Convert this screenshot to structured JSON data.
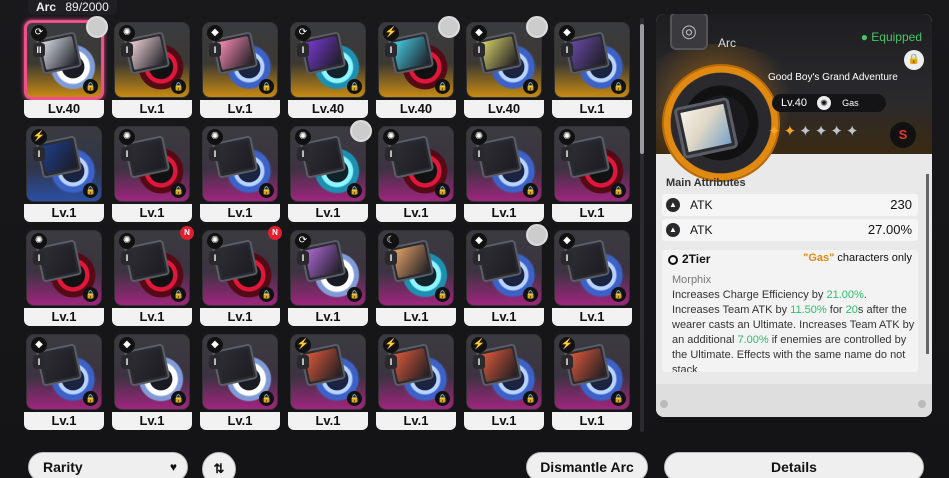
{
  "header": {
    "category": "Arc",
    "count": "89/2000"
  },
  "items": [
    {
      "level": "Lv.40",
      "rarity": "gold",
      "disc": "white",
      "tier": "II",
      "elem": "⟳",
      "art": "#d9e0ea",
      "avatar": true,
      "newbadge": false,
      "selected": true
    },
    {
      "level": "Lv.1",
      "rarity": "gold",
      "disc": "red",
      "tier": "I",
      "elem": "✺",
      "art": "#f2d7dc",
      "avatar": false,
      "newbadge": false,
      "selected": false
    },
    {
      "level": "Lv.1",
      "rarity": "gold",
      "disc": "blue",
      "tier": "I",
      "elem": "◆",
      "art": "#ff8fb6",
      "avatar": false,
      "newbadge": false,
      "selected": false
    },
    {
      "level": "Lv.40",
      "rarity": "gold",
      "disc": "cyan",
      "tier": "I",
      "elem": "⟳",
      "art": "#7a3ad6",
      "avatar": false,
      "newbadge": false,
      "selected": false
    },
    {
      "level": "Lv.40",
      "rarity": "gold",
      "disc": "red",
      "tier": "I",
      "elem": "⚡",
      "art": "#48d0e8",
      "avatar": true,
      "newbadge": false,
      "selected": false
    },
    {
      "level": "Lv.40",
      "rarity": "gold",
      "disc": "blue",
      "tier": "I",
      "elem": "◆",
      "art": "#d9d36a",
      "avatar": true,
      "newbadge": false,
      "selected": false
    },
    {
      "level": "Lv.1",
      "rarity": "gold",
      "disc": "blue",
      "tier": "I",
      "elem": "◆",
      "art": "#6a4aa8",
      "avatar": false,
      "newbadge": false,
      "selected": false
    },
    {
      "level": "Lv.1",
      "rarity": "blue",
      "disc": "blue",
      "tier": "I",
      "elem": "⚡",
      "art": "#1e3f8e",
      "avatar": false,
      "newbadge": false,
      "selected": false
    },
    {
      "level": "Lv.1",
      "rarity": "purple",
      "disc": "red",
      "tier": "I",
      "elem": "✺",
      "art": "#2e2e34",
      "avatar": false,
      "newbadge": false,
      "selected": false
    },
    {
      "level": "Lv.1",
      "rarity": "purple",
      "disc": "blue",
      "tier": "I",
      "elem": "✺",
      "art": "#2e2e34",
      "avatar": false,
      "newbadge": false,
      "selected": false
    },
    {
      "level": "Lv.1",
      "rarity": "purple",
      "disc": "cyan",
      "tier": "I",
      "elem": "✺",
      "art": "#2e2e34",
      "avatar": true,
      "newbadge": false,
      "selected": false
    },
    {
      "level": "Lv.1",
      "rarity": "purple",
      "disc": "red",
      "tier": "I",
      "elem": "✺",
      "art": "#2e2e34",
      "avatar": false,
      "newbadge": false,
      "selected": false
    },
    {
      "level": "Lv.1",
      "rarity": "purple",
      "disc": "blue",
      "tier": "I",
      "elem": "✺",
      "art": "#2e2e34",
      "avatar": false,
      "newbadge": false,
      "selected": false
    },
    {
      "level": "Lv.1",
      "rarity": "purple",
      "disc": "red",
      "tier": "I",
      "elem": "✺",
      "art": "#2e2e34",
      "avatar": false,
      "newbadge": false,
      "selected": false
    },
    {
      "level": "Lv.1",
      "rarity": "purple",
      "disc": "red",
      "tier": "I",
      "elem": "✺",
      "art": "#2e2e34",
      "avatar": false,
      "newbadge": false,
      "selected": false
    },
    {
      "level": "Lv.1",
      "rarity": "purple",
      "disc": "red",
      "tier": "I",
      "elem": "✺",
      "art": "#2e2e34",
      "avatar": false,
      "newbadge": true,
      "selected": false
    },
    {
      "level": "Lv.1",
      "rarity": "purple",
      "disc": "red",
      "tier": "I",
      "elem": "✺",
      "art": "#2e2e34",
      "avatar": false,
      "newbadge": true,
      "selected": false
    },
    {
      "level": "Lv.1",
      "rarity": "purple",
      "disc": "white",
      "tier": "I",
      "elem": "⟳",
      "art": "#b06ad8",
      "avatar": false,
      "newbadge": false,
      "selected": false
    },
    {
      "level": "Lv.1",
      "rarity": "purple",
      "disc": "cyan",
      "tier": "I",
      "elem": "☾",
      "art": "#e8a66a",
      "avatar": false,
      "newbadge": false,
      "selected": false
    },
    {
      "level": "Lv.1",
      "rarity": "purple",
      "disc": "blue",
      "tier": "I",
      "elem": "◆",
      "art": "#2e2e34",
      "avatar": true,
      "newbadge": false,
      "selected": false
    },
    {
      "level": "Lv.1",
      "rarity": "purple",
      "disc": "blue",
      "tier": "I",
      "elem": "◆",
      "art": "#2e2e34",
      "avatar": false,
      "newbadge": false,
      "selected": false
    },
    {
      "level": "Lv.1",
      "rarity": "purple",
      "disc": "blue",
      "tier": "I",
      "elem": "◆",
      "art": "#2e2e34",
      "avatar": false,
      "newbadge": false,
      "selected": false
    },
    {
      "level": "Lv.1",
      "rarity": "purple",
      "disc": "white",
      "tier": "I",
      "elem": "◆",
      "art": "#2e2e34",
      "avatar": false,
      "newbadge": false,
      "selected": false
    },
    {
      "level": "Lv.1",
      "rarity": "purple",
      "disc": "white",
      "tier": "I",
      "elem": "◆",
      "art": "#2e2e34",
      "avatar": false,
      "newbadge": false,
      "selected": false
    },
    {
      "level": "Lv.1",
      "rarity": "purple",
      "disc": "blue",
      "tier": "I",
      "elem": "⚡",
      "art": "#e05a3a",
      "avatar": false,
      "newbadge": false,
      "selected": false
    },
    {
      "level": "Lv.1",
      "rarity": "purple",
      "disc": "blue",
      "tier": "I",
      "elem": "⚡",
      "art": "#e05a3a",
      "avatar": false,
      "newbadge": false,
      "selected": false
    },
    {
      "level": "Lv.1",
      "rarity": "purple",
      "disc": "blue",
      "tier": "I",
      "elem": "⚡",
      "art": "#e05a3a",
      "avatar": false,
      "newbadge": false,
      "selected": false
    },
    {
      "level": "Lv.1",
      "rarity": "purple",
      "disc": "blue",
      "tier": "I",
      "elem": "⚡",
      "art": "#e05a3a",
      "avatar": false,
      "newbadge": false,
      "selected": false
    }
  ],
  "detail": {
    "type": "Arc",
    "status": "Equipped",
    "name": "Good Boy's Grand Adventure",
    "level": "Lv.40",
    "element": "Gas",
    "stars_total": 6,
    "stars_active": 2,
    "main_attributes_label": "Main Attributes",
    "attributes": [
      {
        "name": "ATK",
        "value": "230"
      },
      {
        "name": "ATK",
        "value": "27.00%"
      }
    ],
    "tier_label": "2Tier",
    "requirement_quote": "\"Gas\"",
    "requirement_text": " characters only",
    "effect_name": "Morphix",
    "desc": [
      {
        "t": "Increases Charge Efficiency by "
      },
      {
        "t": "21.00%",
        "h": true
      },
      {
        "t": ". Increases Team ATK by "
      },
      {
        "t": "11.50%",
        "h": true
      },
      {
        "t": " for "
      },
      {
        "t": "20",
        "h": true
      },
      {
        "t": "s after the wearer casts an Ultimate. Increases Team ATK by an additional "
      },
      {
        "t": "7.00%",
        "h": true
      },
      {
        "t": " if enemies are controlled by the Ultimate. Effects with the same name do not stack."
      }
    ]
  },
  "buttons": {
    "rarity": "Rarity",
    "dismantle": "Dismantle Arc",
    "details": "Details"
  },
  "colors": {
    "selected_border": "#f0508a",
    "equipped": "#46c46a",
    "highlight": "#2ebd6b",
    "gold": "#c68a12",
    "purple": "#a0257e"
  }
}
